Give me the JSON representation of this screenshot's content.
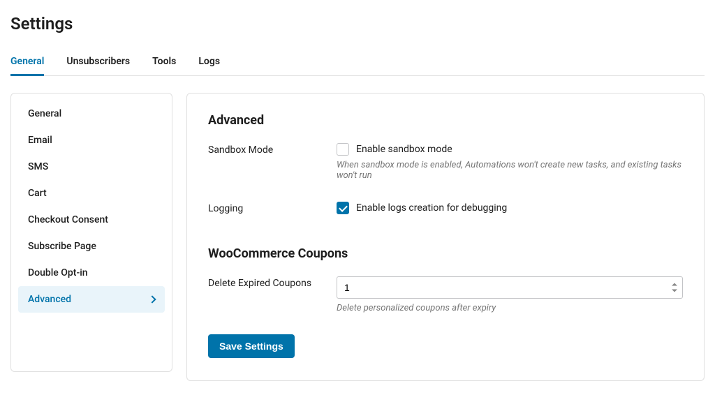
{
  "page_title": "Settings",
  "tabs": {
    "general": "General",
    "unsubscribers": "Unsubscribers",
    "tools": "Tools",
    "logs": "Logs"
  },
  "sidebar": {
    "general": "General",
    "email": "Email",
    "sms": "SMS",
    "cart": "Cart",
    "checkout_consent": "Checkout Consent",
    "subscribe_page": "Subscribe Page",
    "double_optin": "Double Opt-in",
    "advanced": "Advanced"
  },
  "advanced": {
    "heading": "Advanced",
    "sandbox": {
      "label": "Sandbox Mode",
      "checkbox_label": "Enable sandbox mode",
      "checked": false,
      "help": "When sandbox mode is enabled, Automations won't create new tasks, and existing tasks won't run"
    },
    "logging": {
      "label": "Logging",
      "checkbox_label": "Enable logs creation for debugging",
      "checked": true
    }
  },
  "coupons": {
    "heading": "WooCommerce Coupons",
    "delete_expired": {
      "label": "Delete Expired Coupons",
      "value": "1",
      "help": "Delete personalized coupons after expiry"
    }
  },
  "save_button": "Save Settings"
}
